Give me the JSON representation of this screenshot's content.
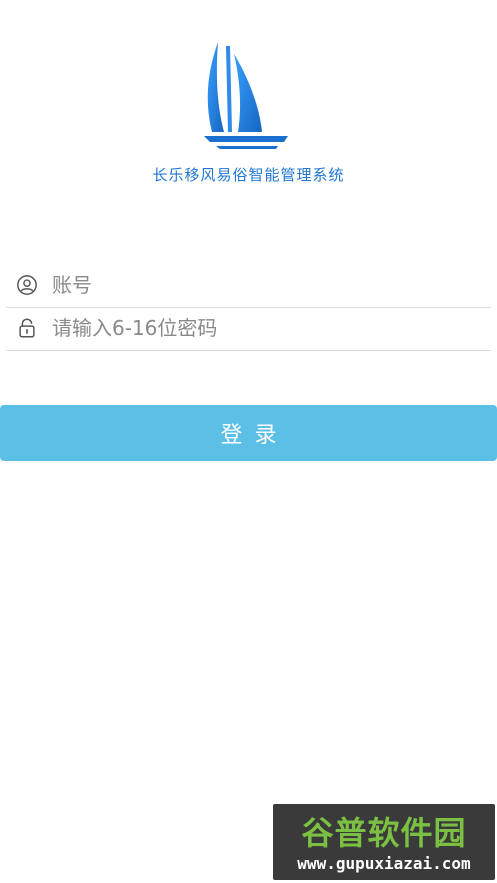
{
  "app": {
    "title": "长乐移风易俗智能管理系统",
    "logo_icon": "sailboat-logo"
  },
  "form": {
    "account": {
      "icon": "user-icon",
      "placeholder": "账号",
      "value": ""
    },
    "password": {
      "icon": "lock-icon",
      "placeholder": "请输入6-16位密码",
      "value": ""
    },
    "login_label": "登录"
  },
  "watermark": {
    "top_text": "谷普软件园",
    "bottom_text": "www.gupuxiazai.com"
  },
  "colors": {
    "brand_blue": "#1f76d3",
    "button": "#5bbfe6",
    "background": "#ffffff"
  }
}
